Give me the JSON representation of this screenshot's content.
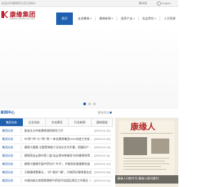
{
  "topbar": {
    "welcome": "欢迎访问康缘药业官方网站！",
    "lang_cn": "繁体版",
    "lang_en": "English"
  },
  "brand": {
    "name": "康缘集团",
    "english": "KANION GROUP CO.,LTD",
    "color": "#b8202e"
  },
  "nav": {
    "items": [
      {
        "label": "首页",
        "active": true
      },
      {
        "label": "走进康缘",
        "caret": true
      },
      {
        "label": "康缘新闻",
        "caret": true
      },
      {
        "label": "投资产业",
        "caret": true
      },
      {
        "label": "社会责任",
        "caret": true
      },
      {
        "label": "人力资源",
        "caret": false
      }
    ],
    "accent": "#1f5fb0"
  },
  "news": {
    "section_title": "新闻中心",
    "more_label": "更多资讯",
    "tabs": [
      {
        "label": "集团动态",
        "active": true
      },
      {
        "label": "企业动态"
      },
      {
        "label": "文化建设"
      },
      {
        "label": "行业新闻"
      },
      {
        "label": "媒体报道"
      }
    ],
    "rows": [
      {
        "category": "集团动态",
        "title": "副省长方伟来康缘调研指导工作",
        "date": "[2024-01-31]"
      },
      {
        "category": "集团动态",
        "title": "市“两”“四”“大”“两”“两”一体化康缘集团2024年度工作部署大会",
        "date": "[2024-01-26]"
      },
      {
        "category": "集团动态",
        "title": "康缘大健康 主题营销推介活动在北京开幕，把握好产健康“健康”",
        "date": "[2024-01-13]"
      },
      {
        "category": "集团动态",
        "title": "康缘获连云港市第三届“连云港市慈善奖”扶持康缘获得集体奖",
        "date": "[2024-02-11]"
      },
      {
        "category": "集团动态",
        "title": "康缘大健康开展中药饮片“冬令”，共推高质量健康发展",
        "date": "[2024-01-10]"
      },
      {
        "category": "集团动态",
        "title": "又精康缘董事长 、“好”“能好”“康”，又做药好康缘基金会",
        "date": "[2024-01-08]"
      },
      {
        "category": "集团动态",
        "title": "市政协副主席视察康缘中药现代化园区建设工作情况（第二批）",
        "date": "[2024-01-04]"
      }
    ]
  },
  "feature": {
    "masthead": "康缘人",
    "caption": "康缘人刊物专刊 康缘人报刊期刊"
  }
}
